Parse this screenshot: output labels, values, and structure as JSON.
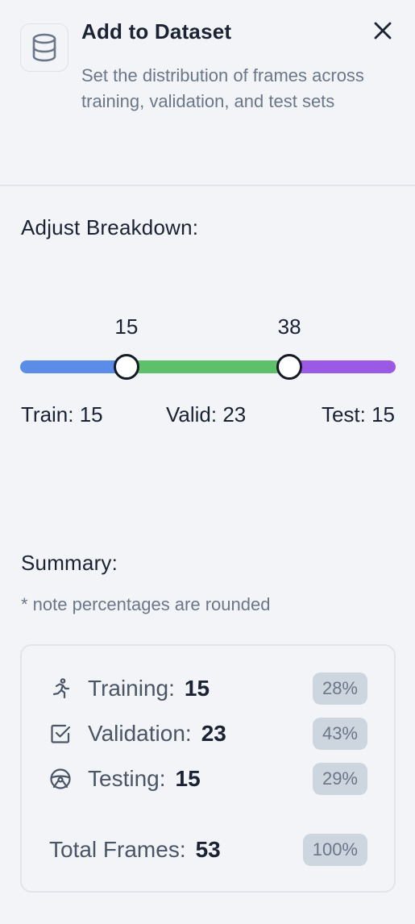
{
  "header": {
    "title": "Add to Dataset",
    "subtitle": "Set the distribution of frames across training, validation, and test sets",
    "icon": "database-icon",
    "close_icon": "close-icon"
  },
  "breakdown": {
    "title": "Adjust Breakdown:",
    "slider": {
      "min": 0,
      "max": 53,
      "handle_1_value": "15",
      "handle_2_value": "38",
      "colors": {
        "train": "#5b8de8",
        "valid": "#5ec16a",
        "test": "#9b5ae6"
      }
    },
    "labels": {
      "train": "Train: 15",
      "valid": "Valid: 23",
      "test": "Test: 15"
    }
  },
  "summary": {
    "title": "Summary:",
    "note": "* note percentages are rounded",
    "rows": [
      {
        "icon": "running-person-icon",
        "label": "Training:",
        "value": "15",
        "percent": "28%"
      },
      {
        "icon": "checkbox-icon",
        "label": "Validation:",
        "value": "23",
        "percent": "43%"
      },
      {
        "icon": "steering-wheel-icon",
        "label": "Testing:",
        "value": "15",
        "percent": "29%"
      }
    ],
    "total": {
      "label": "Total Frames:",
      "value": "53",
      "percent": "100%"
    }
  }
}
